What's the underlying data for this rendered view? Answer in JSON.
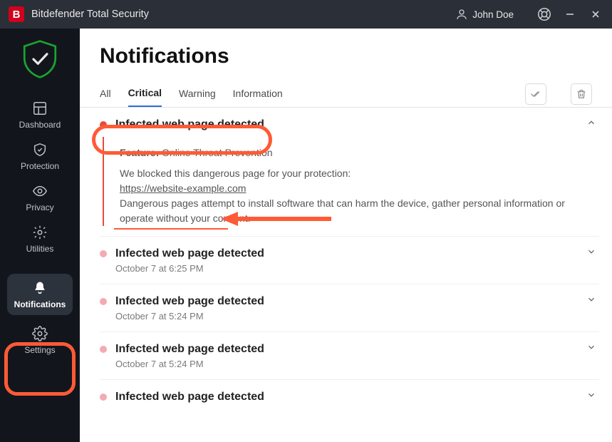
{
  "window": {
    "title": "Bitdefender Total Security",
    "user_name": "John Doe"
  },
  "sidebar": {
    "items": [
      {
        "label": "Dashboard"
      },
      {
        "label": "Protection"
      },
      {
        "label": "Privacy"
      },
      {
        "label": "Utilities"
      },
      {
        "label": "Notifications"
      },
      {
        "label": "Settings"
      }
    ]
  },
  "page": {
    "title": "Notifications",
    "tabs": {
      "all": "All",
      "critical": "Critical",
      "warning": "Warning",
      "information": "Information"
    }
  },
  "expanded": {
    "title": "Infected web page detected",
    "feature_label": "Feature:",
    "feature_value": "Online Threat Prevention",
    "line1": "We blocked this dangerous page for your protection:",
    "url": "https://website-example.com",
    "line2": "Dangerous pages attempt to install software that can harm the device, gather personal information or operate without your consent."
  },
  "entries": [
    {
      "title": "Infected web page detected",
      "time": "October 7 at 6:25 PM"
    },
    {
      "title": "Infected web page detected",
      "time": "October 7 at 5:24 PM"
    },
    {
      "title": "Infected web page detected",
      "time": "October 7 at 5:24 PM"
    },
    {
      "title": "Infected web page detected",
      "time": ""
    }
  ]
}
